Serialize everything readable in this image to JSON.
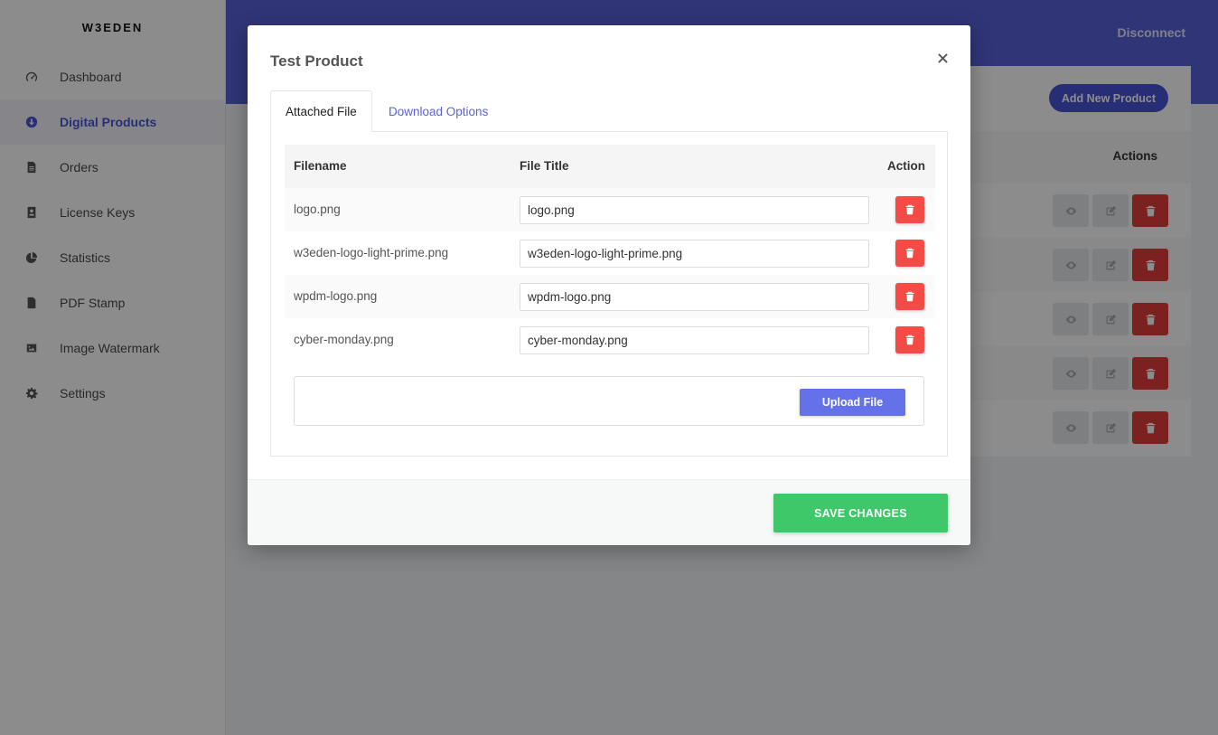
{
  "sidebar": {
    "brand": "W3EDEN",
    "items": [
      {
        "label": "Dashboard",
        "icon": "gauge-icon",
        "active": false
      },
      {
        "label": "Digital Products",
        "icon": "download-circle-icon",
        "active": true
      },
      {
        "label": "Orders",
        "icon": "document-icon",
        "active": false
      },
      {
        "label": "License Keys",
        "icon": "id-card-icon",
        "active": false
      },
      {
        "label": "Statistics",
        "icon": "pie-chart-icon",
        "active": false
      },
      {
        "label": "PDF Stamp",
        "icon": "pdf-file-icon",
        "active": false
      },
      {
        "label": "Image Watermark",
        "icon": "image-icon",
        "active": false
      },
      {
        "label": "Settings",
        "icon": "gear-icon",
        "active": false
      }
    ]
  },
  "topbar": {
    "disconnect_label": "Disconnect"
  },
  "products_card": {
    "add_button_label": "Add New Product",
    "actions_header": "Actions"
  },
  "modal": {
    "title": "Test Product",
    "tabs": [
      {
        "label": "Attached File",
        "active": true
      },
      {
        "label": "Download Options",
        "active": false
      }
    ],
    "table": {
      "headers": {
        "filename": "Filename",
        "file_title": "File Title",
        "action": "Action"
      },
      "rows": [
        {
          "filename": "logo.png",
          "title": "logo.png"
        },
        {
          "filename": "w3eden-logo-light-prime.png",
          "title": "w3eden-logo-light-prime.png"
        },
        {
          "filename": "wpdm-logo.png",
          "title": "wpdm-logo.png"
        },
        {
          "filename": "cyber-monday.png",
          "title": "cyber-monday.png"
        }
      ]
    },
    "upload_label": "Upload File",
    "save_label": "SAVE CHANGES"
  },
  "colors": {
    "primary": "#5661d9",
    "danger": "#f44b47",
    "success": "#3ec86a"
  }
}
